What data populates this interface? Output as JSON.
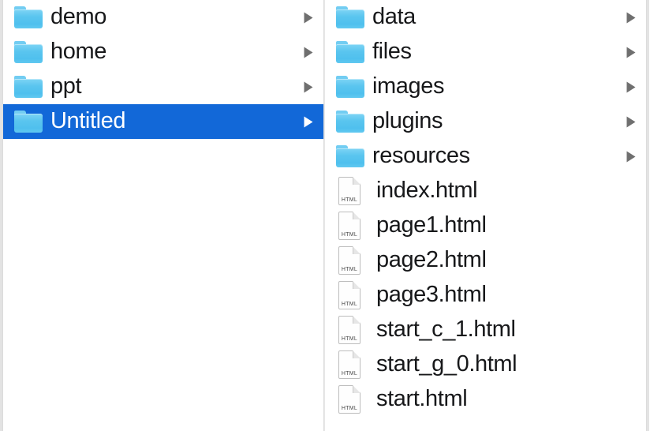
{
  "window": {
    "view_mode": "column-view",
    "background_color": "#ffffff",
    "selection_color": "#1268d8",
    "folder_icon_color": "#5ac5ef",
    "divider_color": "#dcdcdc",
    "chevron_color": "#6f6f6f"
  },
  "columns": [
    {
      "name": "parent-column",
      "items": [
        {
          "label": "demo",
          "kind": "folder",
          "icon": "folder-icon",
          "has_chevron": true,
          "selected": false
        },
        {
          "label": "home",
          "kind": "folder",
          "icon": "folder-icon",
          "has_chevron": true,
          "selected": false
        },
        {
          "label": "ppt",
          "kind": "folder",
          "icon": "folder-icon",
          "has_chevron": true,
          "selected": false
        },
        {
          "label": "Untitled",
          "kind": "folder",
          "icon": "folder-icon",
          "has_chevron": true,
          "selected": true
        }
      ]
    },
    {
      "name": "child-column",
      "items": [
        {
          "label": "data",
          "kind": "folder",
          "icon": "folder-icon",
          "has_chevron": true,
          "selected": false
        },
        {
          "label": "files",
          "kind": "folder",
          "icon": "folder-icon",
          "has_chevron": true,
          "selected": false
        },
        {
          "label": "images",
          "kind": "folder",
          "icon": "folder-icon",
          "has_chevron": true,
          "selected": false
        },
        {
          "label": "plugins",
          "kind": "folder",
          "icon": "folder-icon",
          "has_chevron": true,
          "selected": false
        },
        {
          "label": "resources",
          "kind": "folder",
          "icon": "folder-icon",
          "has_chevron": true,
          "selected": false
        },
        {
          "label": "index.html",
          "kind": "file",
          "icon": "html-file-icon",
          "has_chevron": false,
          "selected": false,
          "ext_badge": "HTML"
        },
        {
          "label": "page1.html",
          "kind": "file",
          "icon": "html-file-icon",
          "has_chevron": false,
          "selected": false,
          "ext_badge": "HTML"
        },
        {
          "label": "page2.html",
          "kind": "file",
          "icon": "html-file-icon",
          "has_chevron": false,
          "selected": false,
          "ext_badge": "HTML"
        },
        {
          "label": "page3.html",
          "kind": "file",
          "icon": "html-file-icon",
          "has_chevron": false,
          "selected": false,
          "ext_badge": "HTML"
        },
        {
          "label": "start_c_1.html",
          "kind": "file",
          "icon": "html-file-icon",
          "has_chevron": false,
          "selected": false,
          "ext_badge": "HTML"
        },
        {
          "label": "start_g_0.html",
          "kind": "file",
          "icon": "html-file-icon",
          "has_chevron": false,
          "selected": false,
          "ext_badge": "HTML"
        },
        {
          "label": "start.html",
          "kind": "file",
          "icon": "html-file-icon",
          "has_chevron": false,
          "selected": false,
          "ext_badge": "HTML"
        }
      ]
    }
  ]
}
